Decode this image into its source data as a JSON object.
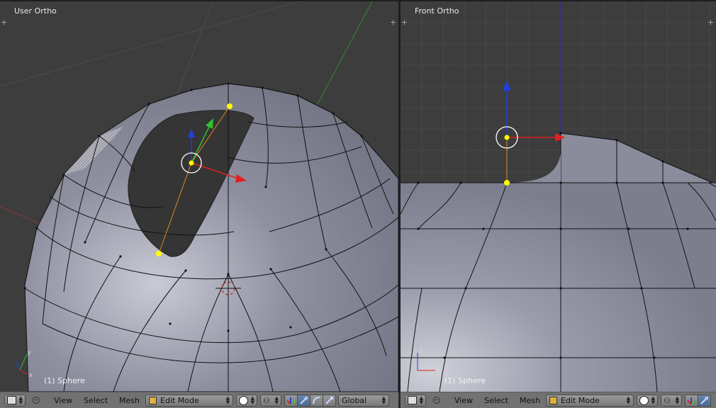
{
  "viewports": {
    "left": {
      "title": "User Ortho",
      "object_name": "(1) Sphere"
    },
    "right": {
      "title": "Front Ortho",
      "object_name": "(1) Sphere"
    }
  },
  "axes": {
    "x": "x",
    "y": "y",
    "z": "z"
  },
  "header": {
    "menus": {
      "view": "View",
      "select": "Select",
      "mesh": "Mesh"
    },
    "mode": "Edit Mode",
    "orientation": "Global"
  },
  "icons": {
    "editor_type": "cube-icon",
    "pivot": "pivot-icon",
    "shading": "sphere-shading-icon",
    "manipulator": [
      "manipulator-icon",
      "translate-icon",
      "rotate-icon",
      "scale-icon"
    ]
  },
  "colors": {
    "background": "#3d3d3d",
    "mesh": "#8d8f9e",
    "selected_vertex": "#ffff00",
    "axis_x": "#e02020",
    "axis_y": "#30c030",
    "axis_z": "#2040e0",
    "header": "#727272"
  }
}
